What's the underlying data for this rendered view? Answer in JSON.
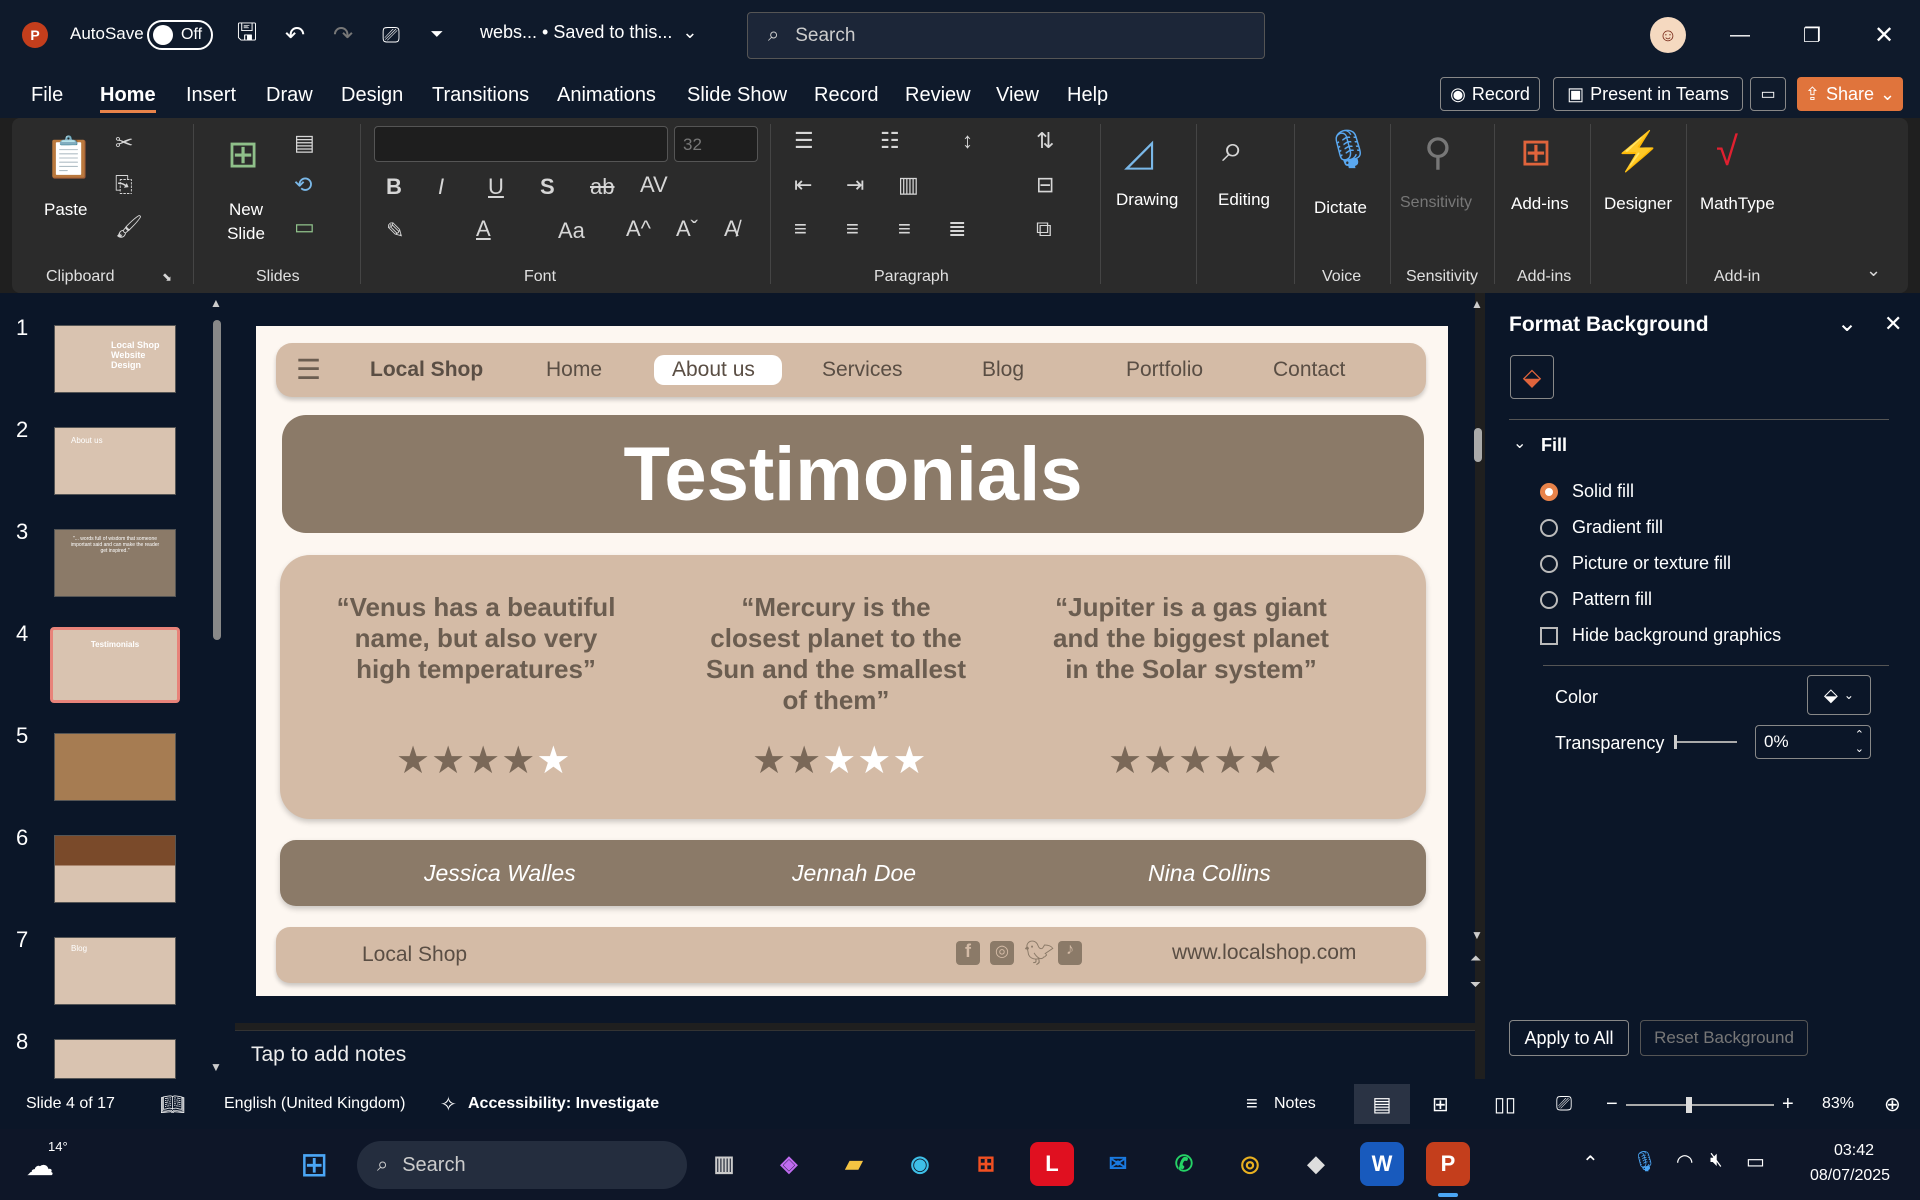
{
  "app": {
    "autosave_label": "AutoSave",
    "autosave_state": "Off",
    "doc_title": "webs... • Saved to this...",
    "search_placeholder": "Search"
  },
  "menu": [
    "File",
    "Home",
    "Insert",
    "Draw",
    "Design",
    "Transitions",
    "Animations",
    "Slide Show",
    "Record",
    "Review",
    "View",
    "Help"
  ],
  "menu_right": {
    "record": "Record",
    "present": "Present in Teams",
    "share": "Share"
  },
  "ribbon": {
    "paste": "Paste",
    "new_slide": "New Slide",
    "font_size": "32",
    "drawing": "Drawing",
    "editing": "Editing",
    "dictate": "Dictate",
    "sensitivity": "Sensitivity",
    "addins": "Add-ins",
    "designer": "Designer",
    "mathtype": "MathType",
    "groups": {
      "clipboard": "Clipboard",
      "slides": "Slides",
      "font": "Font",
      "paragraph": "Paragraph",
      "voice": "Voice",
      "sensitivity": "Sensitivity",
      "addins": "Add-ins",
      "addin": "Add-in"
    }
  },
  "thumbs": {
    "numbers": [
      "1",
      "2",
      "3",
      "4",
      "5",
      "6",
      "7",
      "8"
    ],
    "t1": "Local Shop Website Design",
    "t2": "About us",
    "t3": "\"... words full of wisdom that someone important said and can make the reader get inspired.\"",
    "t4": "Testimonials",
    "t7": "Blog"
  },
  "slide": {
    "nav_brand": "Local Shop",
    "nav": [
      "Home",
      "About us",
      "Services",
      "Blog",
      "Portfolio",
      "Contact"
    ],
    "title": "Testimonials",
    "quotes": [
      "“Venus has a beautiful name, but also very high temperatures”",
      "“Mercury is the closest planet to the Sun and the smallest of them”",
      "“Jupiter is a gas giant and the biggest planet in the Solar system”"
    ],
    "ratings": [
      4,
      2,
      5
    ],
    "names": [
      "Jessica Walles",
      "Jennah Doe",
      "Nina Collins"
    ],
    "footer_brand": "Local Shop",
    "footer_url": "www.localshop.com",
    "colors": {
      "dark": "#8b7a68",
      "light": "#d4bba6",
      "bg": "#fdf7f1",
      "star_filled": "#7a6858",
      "star_empty": "#ffffff"
    }
  },
  "notes": "Tap to add notes",
  "panel": {
    "title": "Format Background",
    "fill": "Fill",
    "options": [
      "Solid fill",
      "Gradient fill",
      "Picture or texture fill",
      "Pattern fill"
    ],
    "hide_bg": "Hide background graphics",
    "color": "Color",
    "transparency": "Transparency",
    "transparency_value": "0%",
    "apply_all": "Apply to All",
    "reset": "Reset Background"
  },
  "status": {
    "slide": "Slide 4 of 17",
    "lang": "English (United Kingdom)",
    "access": "Accessibility: Investigate",
    "notes": "Notes",
    "zoom": "83%"
  },
  "taskbar": {
    "temp": "14°",
    "search": "Search",
    "time": "03:42",
    "date": "08/07/2025"
  }
}
